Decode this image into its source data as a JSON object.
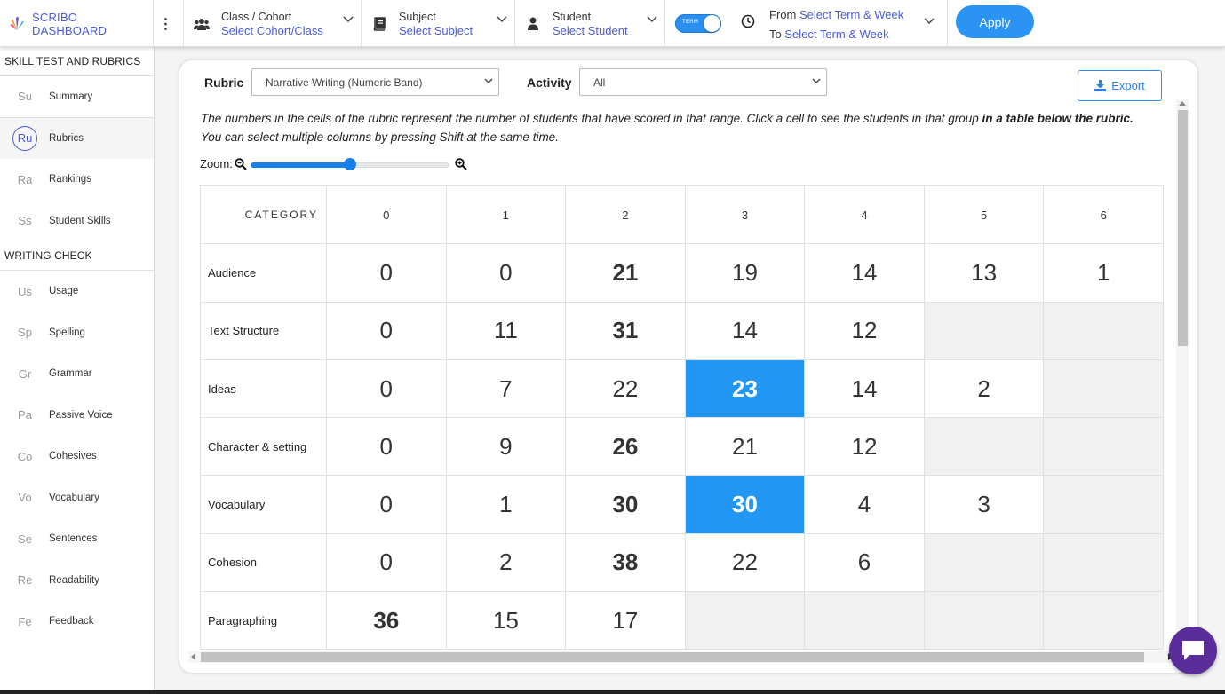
{
  "brand": {
    "name": "SCRIBO DASHBOARD"
  },
  "filters": {
    "class": {
      "label": "Class / Cohort",
      "value": "Select Cohort/Class"
    },
    "subject": {
      "label": "Subject",
      "value": "Select Subject"
    },
    "student": {
      "label": "Student",
      "value": "Select Student"
    }
  },
  "toggle": {
    "label": "TERM"
  },
  "range": {
    "from_label": "From",
    "from_value": "Select Term & Week",
    "to_label": "To",
    "to_value": "Select Term & Week"
  },
  "apply_label": "Apply",
  "sidebar": {
    "section1": "SKILL TEST AND RUBRICS",
    "items1": [
      {
        "abbr": "Su",
        "label": "Summary"
      },
      {
        "abbr": "Ru",
        "label": "Rubrics"
      },
      {
        "abbr": "Ra",
        "label": "Rankings"
      },
      {
        "abbr": "Ss",
        "label": "Student Skills"
      }
    ],
    "section2": "WRITING CHECK",
    "items2": [
      {
        "abbr": "Us",
        "label": "Usage"
      },
      {
        "abbr": "Sp",
        "label": "Spelling"
      },
      {
        "abbr": "Gr",
        "label": "Grammar"
      },
      {
        "abbr": "Pa",
        "label": "Passive Voice"
      },
      {
        "abbr": "Co",
        "label": "Cohesives"
      },
      {
        "abbr": "Vo",
        "label": "Vocabulary"
      },
      {
        "abbr": "Se",
        "label": "Sentences"
      },
      {
        "abbr": "Re",
        "label": "Readability"
      },
      {
        "abbr": "Fe",
        "label": "Feedback"
      }
    ]
  },
  "main": {
    "rubric_label": "Rubric",
    "rubric_value": "Narrative Writing (Numeric Band)",
    "activity_label": "Activity",
    "activity_value": "All",
    "export_label": "Export",
    "note_line1_a": "The numbers in the cells of the rubric represent the number of students that have scored in that range. Click a cell to see the students in that group ",
    "note_line1_b": "in a table below the rubric.",
    "note_line2": "You can select multiple columns by pressing Shift at the same time.",
    "zoom_label": "Zoom:",
    "zoom_level": 0.5
  },
  "table": {
    "category_header": "CATEGORY",
    "columns": [
      "0",
      "1",
      "2",
      "3",
      "4",
      "5",
      "6"
    ],
    "rows": [
      {
        "label": "Audience",
        "cells": [
          "0",
          "0",
          "21",
          "19",
          "14",
          "13",
          "1"
        ],
        "bold": [
          2
        ],
        "selected": []
      },
      {
        "label": "Text Structure",
        "cells": [
          "0",
          "11",
          "31",
          "14",
          "12",
          "",
          ""
        ],
        "bold": [
          2
        ],
        "selected": []
      },
      {
        "label": "Ideas",
        "cells": [
          "0",
          "7",
          "22",
          "23",
          "14",
          "2",
          ""
        ],
        "bold": [],
        "selected": [
          3
        ]
      },
      {
        "label": "Character & setting",
        "cells": [
          "0",
          "9",
          "26",
          "21",
          "12",
          "",
          ""
        ],
        "bold": [
          2
        ],
        "selected": []
      },
      {
        "label": "Vocabulary",
        "cells": [
          "0",
          "1",
          "30",
          "30",
          "4",
          "3",
          ""
        ],
        "bold": [
          2
        ],
        "selected": [
          3
        ]
      },
      {
        "label": "Cohesion",
        "cells": [
          "0",
          "2",
          "38",
          "22",
          "6",
          "",
          ""
        ],
        "bold": [
          2
        ],
        "selected": []
      },
      {
        "label": "Paragraphing",
        "cells": [
          "36",
          "15",
          "17",
          "",
          "",
          "",
          ""
        ],
        "bold": [
          0
        ],
        "selected": []
      }
    ]
  },
  "colors": {
    "accent": "#4a5bd8",
    "selected_cell": "#2196f3",
    "apply": "#2b94f2",
    "chat": "#5a2d9a"
  }
}
